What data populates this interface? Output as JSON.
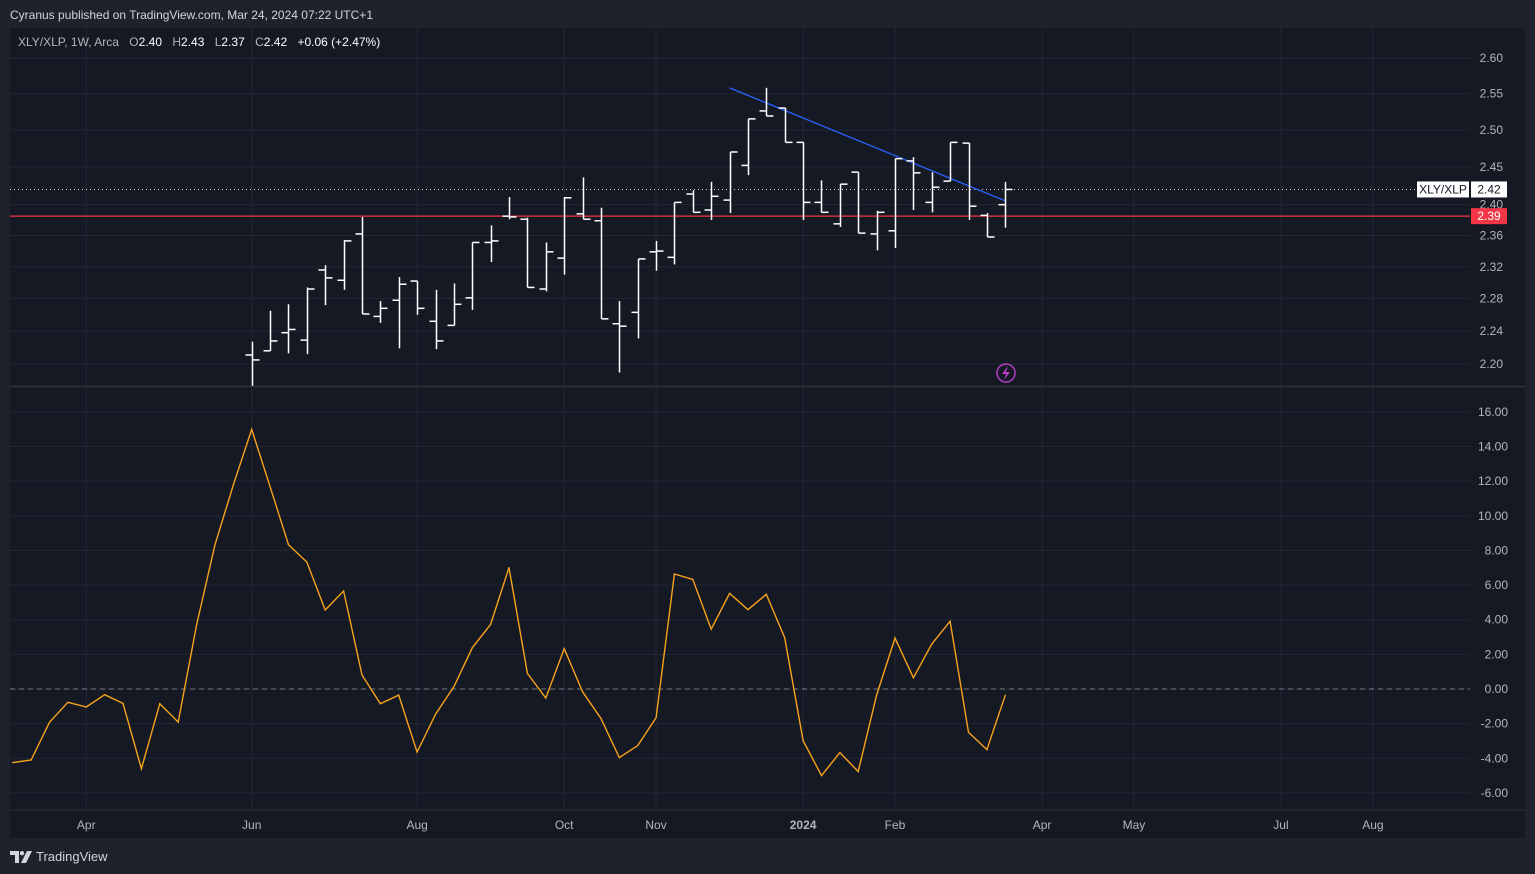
{
  "caption": "Cyranus published on TradingView.com, Mar 24, 2024 07:22 UTC+1",
  "legend": {
    "symbol": "XLY/XLP, 1W, Arca",
    "o_label": "O",
    "o": "2.40",
    "h_label": "H",
    "h": "2.43",
    "l_label": "L",
    "l": "2.37",
    "c_label": "C",
    "c": "2.42",
    "change": "+0.06 (+2.47%)"
  },
  "footer": {
    "brand": "TradingView"
  },
  "colors": {
    "background": "#151924",
    "frame": "#1e222d",
    "bars": "#ffffff",
    "oscillator": "#f7a21b",
    "support_line": "#f23645",
    "trendline": "#2962ff",
    "grid": "#232734",
    "alert_icon": "#b63ec8"
  },
  "icons": {
    "alert": "lightning-bolt-icon",
    "logo": "tradingview-logo-icon"
  },
  "chart_data": [
    {
      "type": "ohlc",
      "scale": "log",
      "symbol": "XLY/XLP",
      "ylim": [
        2.18,
        2.62
      ],
      "yticks": [
        "2.60",
        "2.55",
        "2.50",
        "2.45",
        "2.40",
        "2.36",
        "2.32",
        "2.28",
        "2.24",
        "2.20"
      ],
      "last_price_label": {
        "name": "XLY/XLP",
        "value": "2.42",
        "price": 2.42
      },
      "horizontal_line": {
        "price": 2.385,
        "label": "2.39"
      },
      "trendline": {
        "start": [
          "2023-12-04",
          2.558
        ],
        "end": [
          "2024-03-18",
          2.405
        ]
      },
      "bars_columns": [
        "date",
        "open",
        "high",
        "low",
        "close"
      ],
      "bars": [
        [
          "2023-06-05",
          2.211,
          2.227,
          2.174,
          2.205
        ],
        [
          "2023-06-12",
          2.216,
          2.265,
          2.216,
          2.228
        ],
        [
          "2023-06-19",
          2.238,
          2.273,
          2.213,
          2.242
        ],
        [
          "2023-06-26",
          2.229,
          2.294,
          2.212,
          2.292
        ],
        [
          "2023-07-03",
          2.316,
          2.322,
          2.272,
          2.306
        ],
        [
          "2023-07-10",
          2.303,
          2.354,
          2.291,
          2.353
        ],
        [
          "2023-07-17",
          2.362,
          2.384,
          2.261,
          2.261
        ],
        [
          "2023-07-24",
          2.258,
          2.277,
          2.25,
          2.268
        ],
        [
          "2023-07-31",
          2.278,
          2.307,
          2.219,
          2.298
        ],
        [
          "2023-08-07",
          2.302,
          2.302,
          2.26,
          2.268
        ],
        [
          "2023-08-14",
          2.252,
          2.291,
          2.218,
          2.228
        ],
        [
          "2023-08-21",
          2.247,
          2.299,
          2.247,
          2.273
        ],
        [
          "2023-08-28",
          2.281,
          2.351,
          2.266,
          2.351
        ],
        [
          "2023-09-04",
          2.351,
          2.373,
          2.326,
          2.353
        ],
        [
          "2023-09-11",
          2.385,
          2.41,
          2.381,
          2.384
        ],
        [
          "2023-09-18",
          2.381,
          2.383,
          2.294,
          2.294
        ],
        [
          "2023-09-25",
          2.292,
          2.351,
          2.289,
          2.339
        ],
        [
          "2023-10-02",
          2.331,
          2.41,
          2.31,
          2.409
        ],
        [
          "2023-10-09",
          2.388,
          2.436,
          2.381,
          2.381
        ],
        [
          "2023-10-16",
          2.379,
          2.396,
          2.255,
          2.255
        ],
        [
          "2023-10-23",
          2.249,
          2.277,
          2.19,
          2.246
        ],
        [
          "2023-10-30",
          2.263,
          2.33,
          2.231,
          2.33
        ],
        [
          "2023-11-06",
          2.339,
          2.353,
          2.315,
          2.34
        ],
        [
          "2023-11-13",
          2.332,
          2.403,
          2.323,
          2.403
        ],
        [
          "2023-11-20",
          2.414,
          2.419,
          2.39,
          2.39
        ],
        [
          "2023-11-27",
          2.393,
          2.43,
          2.38,
          2.411
        ],
        [
          "2023-12-04",
          2.406,
          2.47,
          2.389,
          2.47
        ],
        [
          "2023-12-11",
          2.452,
          2.515,
          2.439,
          2.515
        ],
        [
          "2023-12-18",
          2.526,
          2.558,
          2.519,
          2.519
        ],
        [
          "2023-12-25",
          2.53,
          2.53,
          2.483,
          2.483
        ],
        [
          "2024-01-01",
          2.483,
          2.483,
          2.38,
          2.403
        ],
        [
          "2024-01-08",
          2.403,
          2.432,
          2.39,
          2.39
        ],
        [
          "2024-01-15",
          2.375,
          2.427,
          2.371,
          2.427
        ],
        [
          "2024-01-22",
          2.443,
          2.443,
          2.363,
          2.363
        ],
        [
          "2024-01-29",
          2.362,
          2.392,
          2.341,
          2.39
        ],
        [
          "2024-02-05",
          2.366,
          2.461,
          2.344,
          2.461
        ],
        [
          "2024-02-12",
          2.458,
          2.463,
          2.393,
          2.442
        ],
        [
          "2024-02-19",
          2.403,
          2.443,
          2.39,
          2.423
        ],
        [
          "2024-02-26",
          2.431,
          2.483,
          2.431,
          2.483
        ],
        [
          "2024-03-04",
          2.482,
          2.482,
          2.38,
          2.398
        ],
        [
          "2024-03-11",
          2.386,
          2.389,
          2.358,
          2.358
        ],
        [
          "2024-03-18",
          2.4,
          2.43,
          2.37,
          2.42
        ]
      ]
    },
    {
      "type": "line",
      "ylim": [
        -7,
        17
      ],
      "yticks": [
        "16.00",
        "14.00",
        "12.00",
        "10.00",
        "8.00",
        "6.00",
        "4.00",
        "2.00",
        "0.00",
        "-2.00",
        "-4.00",
        "-6.00"
      ],
      "zero_line": 0,
      "points_columns": [
        "date",
        "value"
      ],
      "points": [
        [
          "2023-03-06",
          -4.25
        ],
        [
          "2023-03-13",
          -4.1
        ],
        [
          "2023-03-20",
          -1.92
        ],
        [
          "2023-03-27",
          -0.77
        ],
        [
          "2023-04-03",
          -1.04
        ],
        [
          "2023-04-10",
          -0.33
        ],
        [
          "2023-04-17",
          -0.83
        ],
        [
          "2023-04-24",
          -4.6
        ],
        [
          "2023-05-01",
          -0.85
        ],
        [
          "2023-05-08",
          -1.91
        ],
        [
          "2023-05-15",
          3.7
        ],
        [
          "2023-05-22",
          8.31
        ],
        [
          "2023-05-29",
          11.78
        ],
        [
          "2023-06-05",
          14.99
        ],
        [
          "2023-06-12",
          11.68
        ],
        [
          "2023-06-19",
          8.33
        ],
        [
          "2023-06-26",
          7.33
        ],
        [
          "2023-07-03",
          4.56
        ],
        [
          "2023-07-10",
          5.66
        ],
        [
          "2023-07-17",
          0.81
        ],
        [
          "2023-07-24",
          -0.85
        ],
        [
          "2023-07-31",
          -0.35
        ],
        [
          "2023-08-07",
          -3.64
        ],
        [
          "2023-08-14",
          -1.46
        ],
        [
          "2023-08-21",
          0.13
        ],
        [
          "2023-08-28",
          2.38
        ],
        [
          "2023-09-04",
          3.73
        ],
        [
          "2023-09-11",
          7.01
        ],
        [
          "2023-09-18",
          0.9
        ],
        [
          "2023-09-25",
          -0.52
        ],
        [
          "2023-10-02",
          2.33
        ],
        [
          "2023-10-09",
          -0.15
        ],
        [
          "2023-10-16",
          -1.69
        ],
        [
          "2023-10-23",
          -3.96
        ],
        [
          "2023-10-30",
          -3.27
        ],
        [
          "2023-11-06",
          -1.65
        ],
        [
          "2023-11-13",
          6.64
        ],
        [
          "2023-11-20",
          6.33
        ],
        [
          "2023-11-27",
          3.46
        ],
        [
          "2023-12-04",
          5.52
        ],
        [
          "2023-12-11",
          4.58
        ],
        [
          "2023-12-18",
          5.47
        ],
        [
          "2023-12-25",
          2.96
        ],
        [
          "2024-01-01",
          -2.98
        ],
        [
          "2024-01-08",
          -5.0
        ],
        [
          "2024-01-15",
          -3.67
        ],
        [
          "2024-01-22",
          -4.77
        ],
        [
          "2024-01-29",
          -0.35
        ],
        [
          "2024-02-05",
          2.94
        ],
        [
          "2024-02-12",
          0.65
        ],
        [
          "2024-02-19",
          2.6
        ],
        [
          "2024-02-26",
          3.91
        ],
        [
          "2024-03-04",
          -2.5
        ],
        [
          "2024-03-11",
          -3.5
        ],
        [
          "2024-03-18",
          -0.36
        ]
      ]
    }
  ],
  "xaxis": {
    "ticks": [
      {
        "label": "Apr",
        "date": "2023-04-03"
      },
      {
        "label": "Jun",
        "date": "2023-06-05"
      },
      {
        "label": "Aug",
        "date": "2023-08-07"
      },
      {
        "label": "Oct",
        "date": "2023-10-02"
      },
      {
        "label": "Nov",
        "date": "2023-11-06"
      },
      {
        "label": "2024",
        "date": "2024-01-01",
        "bold": true
      },
      {
        "label": "Feb",
        "date": "2024-02-05"
      },
      {
        "label": "Apr",
        "date": "2024-04-01"
      },
      {
        "label": "May",
        "date": "2024-05-06"
      },
      {
        "label": "Jul",
        "date": "2024-07-01"
      },
      {
        "label": "Aug",
        "date": "2024-08-05"
      }
    ]
  }
}
